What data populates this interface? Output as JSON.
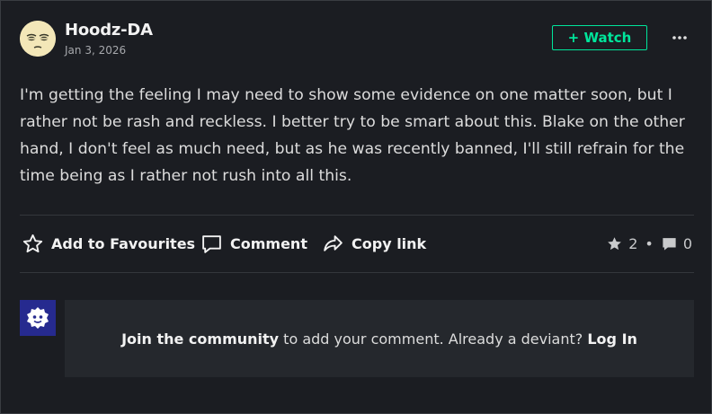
{
  "post": {
    "username": "Hoodz-DA",
    "date": "Jan 3, 2026",
    "watch_label": "+ Watch",
    "body": "I'm getting the feeling I may need to show some evidence on one matter soon, but I rather not be rash and reckless.  I better try to be smart about this.  Blake on the other hand, I don't feel as much need, but as he was recently banned, I'll still refrain for the time being as I rather not rush into all this."
  },
  "actions": {
    "favourite_label": "Add to Favourites",
    "comment_label": "Comment",
    "copy_link_label": "Copy link"
  },
  "stats": {
    "favourites": "2",
    "comments": "0"
  },
  "join": {
    "bold_text": "Join the community",
    "mid_text": "to add your comment. Already a deviant?",
    "login_label": "Log In"
  },
  "colors": {
    "accent": "#00e59b",
    "background": "#1b1d22",
    "panel": "#25282d",
    "community_icon_bg": "#262a8f"
  }
}
